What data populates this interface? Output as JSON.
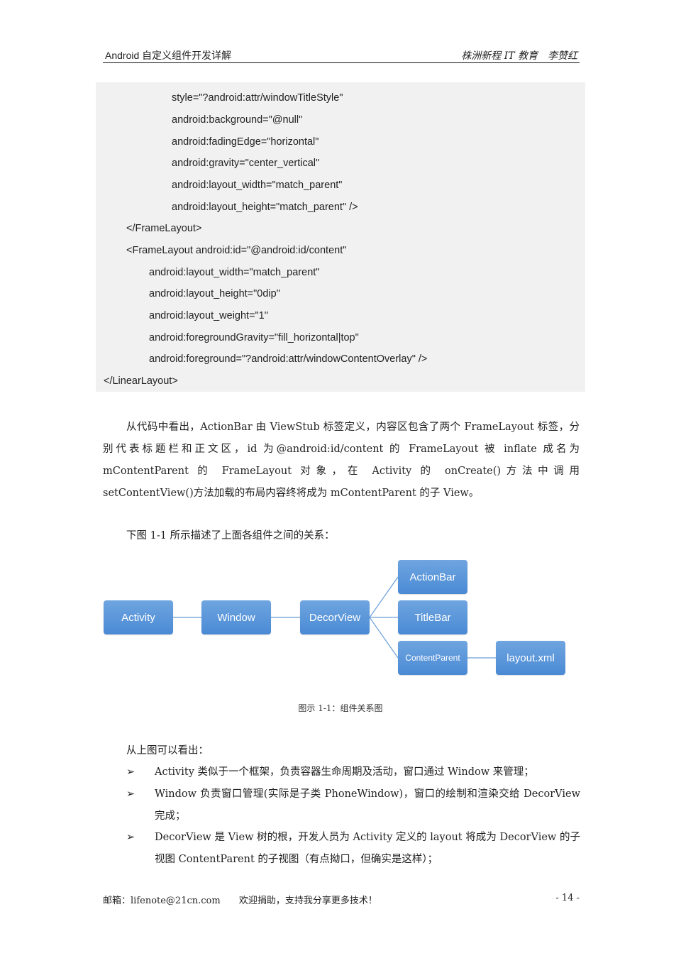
{
  "header": {
    "book_title": "Android 自定义组件开发详解",
    "publisher": "株洲新程 IT 教育",
    "author": "李赞红"
  },
  "code": {
    "lines": [
      "style=\"?android:attr/windowTitleStyle\"",
      "android:background=\"@null\"",
      "android:fadingEdge=\"horizontal\"",
      "android:gravity=\"center_vertical\"",
      "android:layout_width=\"match_parent\"",
      "android:layout_height=\"match_parent\" />",
      "</FrameLayout>",
      "<FrameLayout android:id=\"@android:id/content\"",
      "android:layout_width=\"match_parent\"",
      "android:layout_height=\"0dip\"",
      "android:layout_weight=\"1\"",
      "android:foregroundGravity=\"fill_horizontal|top\"",
      "android:foreground=\"?android:attr/windowContentOverlay\" />",
      "</LinearLayout>"
    ]
  },
  "paragraph1": "从代码中看出，ActionBar 由 ViewStub 标签定义，内容区包含了两个 FrameLayout 标签，分别代表标题栏和正文区，id 为@android:id/content 的 FrameLayout 被 inflate 成名为 mContentParent 的 FrameLayout 对象，在 Activity 的 onCreate()方法中调用 setContentView()方法加载的布局内容终将成为 mContentParent 的子 View。",
  "paragraph2": "下图 1-1 所示描述了上面各组件之间的关系：",
  "diagram": {
    "nodes": {
      "activity": "Activity",
      "window": "Window",
      "decorview": "DecorView",
      "actionbar": "ActionBar",
      "titlebar": "TitleBar",
      "contentparent": "ContentParent",
      "layout": "layout.xml"
    },
    "node_color": "#5b9bd5",
    "caption": "图示 1-1：组件关系图"
  },
  "paragraph3": "从上图可以看出：",
  "bullets": {
    "marker": "➢",
    "items": [
      "Activity 类似于一个框架，负责容器生命周期及活动，窗口通过 Window 来管理；",
      "Window 负责窗口管理(实际是子类 PhoneWindow)，窗口的绘制和渲染交给 DecorView 完成；",
      "DecorView 是 View 树的根，开发人员为 Activity 定义的 layout 将成为 DecorView 的子视图 ContentParent 的子视图（有点拗口，但确实是这样）；"
    ]
  },
  "footer": {
    "email": "邮箱：lifenote@21cn.com",
    "slogan": "欢迎捐助，支持我分享更多技术！",
    "page": "- 14 -"
  }
}
